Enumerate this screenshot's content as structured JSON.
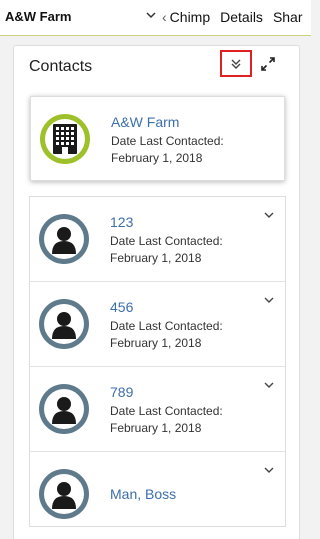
{
  "header": {
    "record_title": "A&W Farm",
    "tab_overflow": "‹",
    "tabs": [
      "Chimp",
      "Details",
      "Shar"
    ]
  },
  "panel": {
    "title": "Contacts",
    "collapse_icon": "double-chevron-down-icon",
    "expand_icon": "expand-arrows-icon"
  },
  "featured": {
    "name": "A&W Farm",
    "label": "Date Last Contacted:",
    "date": "February 1, 2018",
    "icon": "building-icon",
    "accent": "#9ec02a"
  },
  "contacts": [
    {
      "name": "123",
      "label": "Date Last Contacted:",
      "date": "February 1, 2018"
    },
    {
      "name": "456",
      "label": "Date Last Contacted:",
      "date": "February 1, 2018"
    },
    {
      "name": "789",
      "label": "Date Last Contacted:",
      "date": "February 1, 2018"
    },
    {
      "name": "Man, Boss"
    }
  ],
  "colors": {
    "link": "#3d6fa8",
    "person_ring": "#5f7b8b",
    "highlight": "#e02020"
  }
}
